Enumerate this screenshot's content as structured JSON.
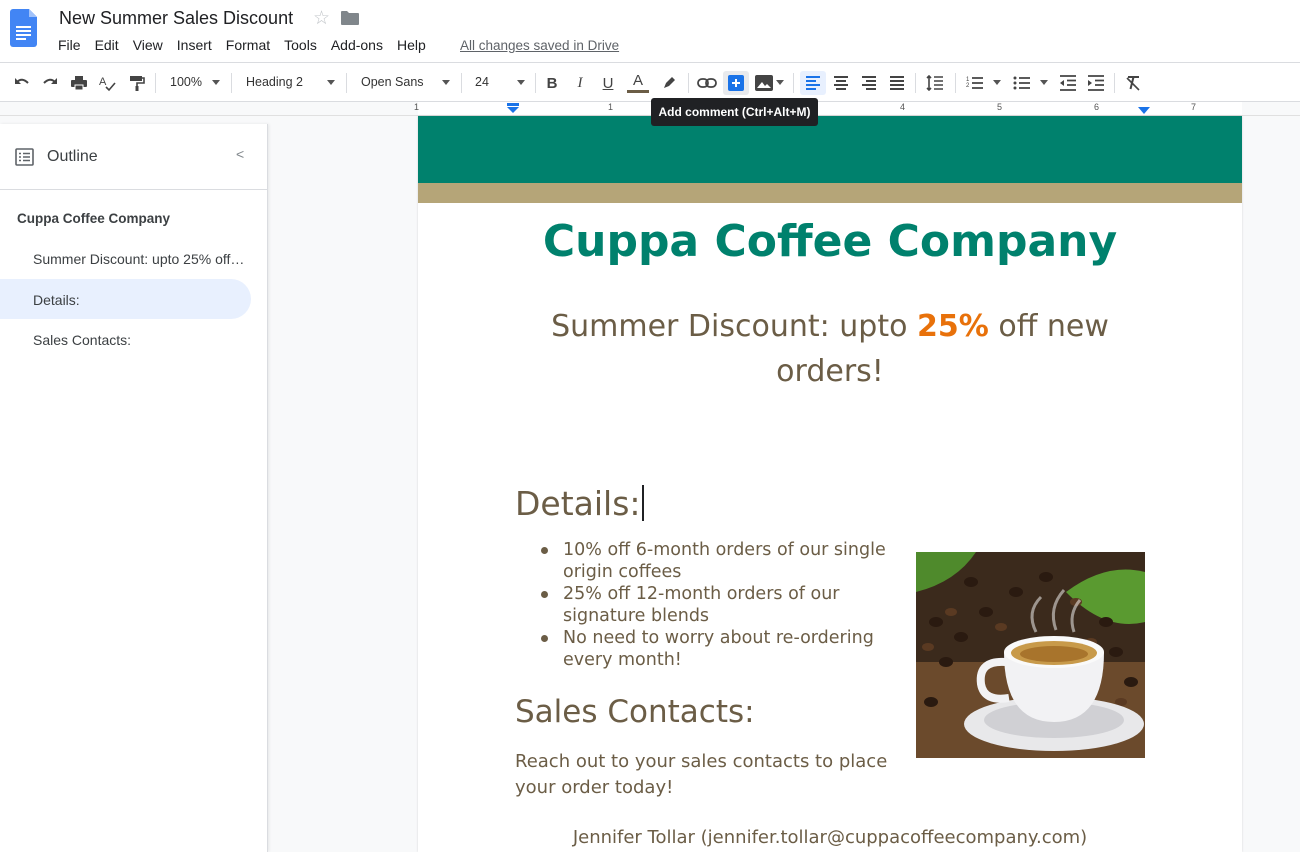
{
  "app": {
    "doc_title": "New Summer Sales Discount",
    "saved_status": "All changes saved in Drive",
    "menu": [
      "File",
      "Edit",
      "View",
      "Insert",
      "Format",
      "Tools",
      "Add-ons",
      "Help"
    ]
  },
  "toolbar": {
    "zoom": "100%",
    "style": "Heading 2",
    "font": "Open Sans",
    "font_size": "24",
    "bold_label": "B",
    "italic_label": "I",
    "underline_label": "U",
    "text_color_label": "A",
    "tooltip": "Add comment (Ctrl+Alt+M)",
    "icons": [
      "undo-icon",
      "redo-icon",
      "print-icon",
      "spellcheck-icon",
      "paint-format-icon",
      "bold-icon",
      "italic-icon",
      "underline-icon",
      "text-color-icon",
      "highlight-icon",
      "link-icon",
      "add-comment-icon",
      "insert-image-icon",
      "align-left-icon",
      "align-center-icon",
      "align-right-icon",
      "justify-icon",
      "line-spacing-icon",
      "numbered-list-icon",
      "bulleted-list-icon",
      "decrease-indent-icon",
      "increase-indent-icon",
      "clear-formatting-icon"
    ]
  },
  "ruler": {
    "numbers": [
      "1",
      "1",
      "2",
      "3",
      "4",
      "5",
      "6",
      "7"
    ]
  },
  "outline": {
    "title": "Outline",
    "items": [
      {
        "label": "Cuppa Coffee Company",
        "level": 1
      },
      {
        "label": "Summer Discount: upto 25% off…",
        "level": 2
      },
      {
        "label": "Details:",
        "level": 2,
        "active": true
      },
      {
        "label": "Sales Contacts:",
        "level": 2
      }
    ]
  },
  "document": {
    "company_title": "Cuppa Coffee Company",
    "discount_before": "Summer Discount: upto ",
    "discount_pct": "25%",
    "discount_after": " off new orders!",
    "details_heading": "Details:",
    "details_items": [
      "10% off 6-month orders of our single origin coffees",
      "25% off 12-month orders of our signature blends",
      "No need to worry about re-ordering every month!"
    ],
    "sales_heading": "Sales Contacts:",
    "sales_text": "Reach out to your sales contacts to place your order today!",
    "contact_line": "Jennifer Tollar (jennifer.tollar@cuppacoffeecompany.com)",
    "image": "coffee-cup-with-beans",
    "colors": {
      "banner_green": "#00816d",
      "banner_gold": "#b5a578",
      "text_brown": "#6b5d46",
      "accent_orange": "#e8710a"
    }
  }
}
